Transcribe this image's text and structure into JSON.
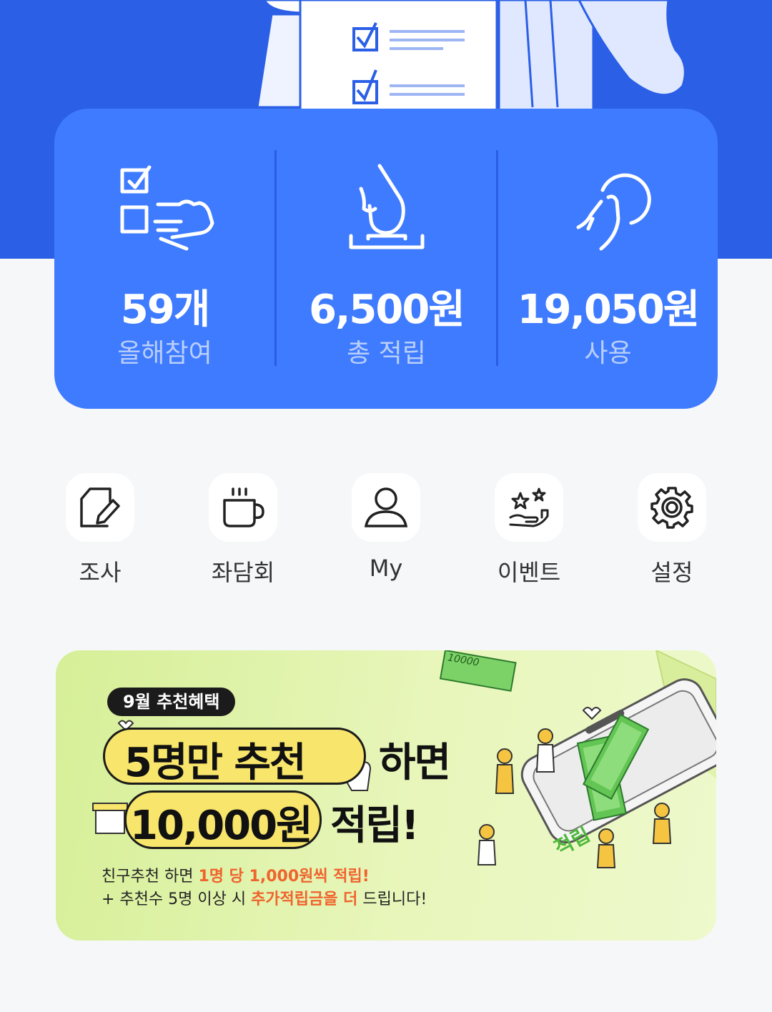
{
  "stats": [
    {
      "value": "59개",
      "label": "올해참여",
      "icon": "checklist-hand-icon"
    },
    {
      "value": "6,500원",
      "label": "총 적립",
      "icon": "deposit-hand-icon"
    },
    {
      "value": "19,050원",
      "label": "사용",
      "icon": "coin-hand-icon"
    }
  ],
  "menu": [
    {
      "label": "조사",
      "icon": "survey-edit-icon"
    },
    {
      "label": "좌담회",
      "icon": "coffee-cup-icon"
    },
    {
      "label": "My",
      "icon": "user-icon"
    },
    {
      "label": "이벤트",
      "icon": "event-stars-hand-icon"
    },
    {
      "label": "설정",
      "icon": "gear-icon"
    }
  ],
  "banner": {
    "badge": "9월 추천혜택",
    "headline1": "5명만 추천",
    "headline1_suffix": "하면",
    "headline2": "10,000원",
    "headline2_suffix": "적립!",
    "line1_prefix": "친구추천 하면 ",
    "line1_highlight": "1명 당 1,000원씩 적립!",
    "line2_prefix": "+ 추천수 5명 이상 시 ",
    "line2_highlight": "추가적립금을 더",
    "line2_suffix": " 드립니다!",
    "bill_text": "10000",
    "phone_text": "적립"
  },
  "colors": {
    "hero_bg": "#2a5fe6",
    "card_bg": "#3f7bff",
    "label_color": "#b9cffc",
    "highlight": "#f0632d",
    "pill_yellow": "#f8e56b"
  }
}
